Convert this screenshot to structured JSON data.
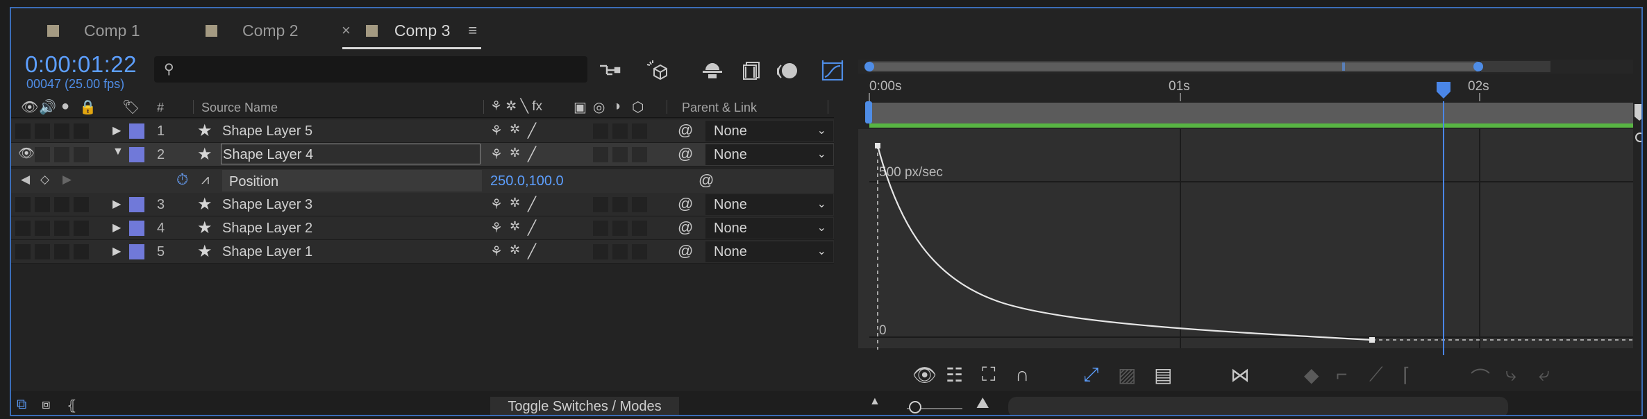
{
  "tabs": [
    {
      "label": "Comp 1",
      "active": false
    },
    {
      "label": "Comp 2",
      "active": false
    },
    {
      "label": "Comp 3",
      "active": true
    }
  ],
  "tab_close": "×",
  "tab_menu": "≡",
  "timecode": "0:00:01:22",
  "frame_info": "00047 (25.00 fps)",
  "search": {
    "placeholder": "",
    "value": "",
    "icon": "search-icon"
  },
  "columns": {
    "number": "#",
    "source_name": "Source Name",
    "switches_glyphs": "⚘ ✲ ╲ fx",
    "parent_link": "Parent & Link"
  },
  "layers": [
    {
      "index": "1",
      "name": "Shape Layer 5",
      "parent": "None",
      "expanded": false,
      "selected": false,
      "visible": false
    },
    {
      "index": "2",
      "name": "Shape Layer 4",
      "parent": "None",
      "expanded": true,
      "selected": true,
      "visible": true
    },
    {
      "index": "3",
      "name": "Shape Layer 3",
      "parent": "None",
      "expanded": false,
      "selected": false,
      "visible": false
    },
    {
      "index": "4",
      "name": "Shape Layer 2",
      "parent": "None",
      "expanded": false,
      "selected": false,
      "visible": false
    },
    {
      "index": "5",
      "name": "Shape Layer 1",
      "parent": "None",
      "expanded": false,
      "selected": false,
      "visible": false
    }
  ],
  "property": {
    "name": "Position",
    "value": "250.0,100.0"
  },
  "timeline": {
    "ruler_labels": [
      "0:00s",
      "01s",
      "02s"
    ],
    "current_time_seconds": 1.88,
    "duration_seconds": 2.5
  },
  "graph": {
    "label_top": "500 px/sec",
    "label_bottom": "0",
    "curve_type": "speed-graph"
  },
  "footer": {
    "toggle_label": "Toggle Switches / Modes"
  },
  "colors": {
    "accent": "#4f8de6",
    "layer_label": "#7079d9",
    "work_area": "#58b543",
    "playhead": "#4a86e8"
  }
}
